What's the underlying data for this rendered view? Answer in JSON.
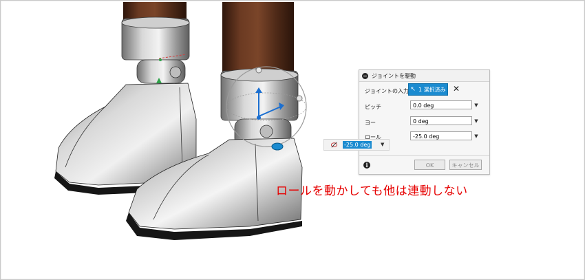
{
  "panel": {
    "title": "ジョイントを駆動",
    "joint_input_label": "ジョイントの入力",
    "selection_label": "1 選択済み",
    "pitch_label": "ピッチ",
    "pitch_value": "0.0 deg",
    "yaw_label": "ヨー",
    "yaw_value": "0 deg",
    "roll_label": "ロール",
    "roll_value": "-25.0 deg",
    "ok_label": "OK",
    "cancel_label": "キャンセル"
  },
  "inline_editor": {
    "value": "-25.0 deg"
  },
  "annotation": {
    "text": "ロールを動かしても他は連動しない",
    "color": "#e60000"
  },
  "colors": {
    "accent": "#1b8bd0",
    "wood": "#5a2f1a",
    "boot_silver": "#b8b8b8",
    "sole": "#1a1a1a"
  }
}
